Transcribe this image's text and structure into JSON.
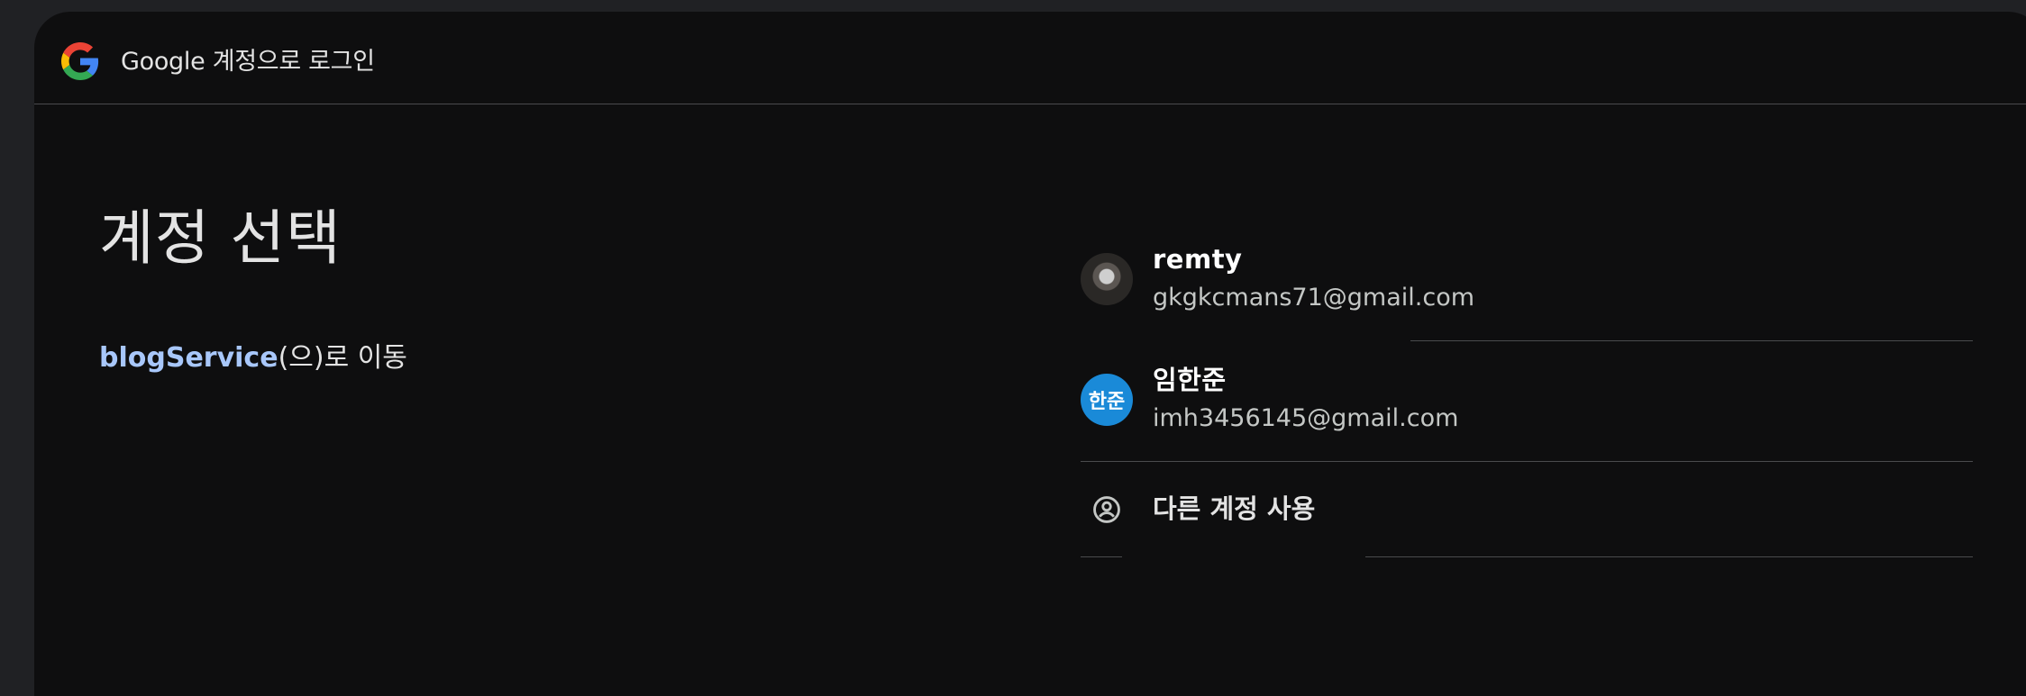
{
  "header": {
    "logo_icon": "google-g-icon",
    "title": "Google 계정으로 로그인"
  },
  "main": {
    "page_title": "계정 선택",
    "app_name": "blogService",
    "app_suffix": "(으)로 이동"
  },
  "accounts": [
    {
      "name": "remty",
      "email": "gkgkcmans71@gmail.com",
      "avatar_type": "photo"
    },
    {
      "name": "임한준",
      "email": "imh3456145@gmail.com",
      "avatar_type": "letter",
      "avatar_letter": "한준",
      "avatar_color": "#1a8ad8"
    }
  ],
  "other_account": {
    "icon": "add-account-icon",
    "label": "다른 계정 사용"
  },
  "colors": {
    "background": "#0e0e0f",
    "link": "#a8c7fa",
    "text": "#e3e3e3"
  }
}
